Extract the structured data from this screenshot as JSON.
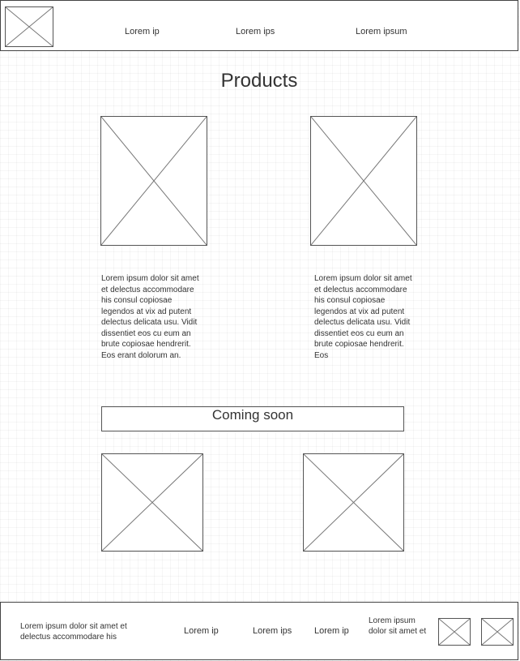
{
  "header": {
    "logo_icon": "image-placeholder-icon",
    "nav_links": [
      "Lorem ip",
      "Lorem ips",
      "Lorem ipsum"
    ]
  },
  "main": {
    "title": "Products",
    "products": [
      {
        "image_icon": "image-placeholder-icon",
        "description": "Lorem ipsum dolor sit amet et delectus accommodare his consul copiosae legendos at vix ad putent delectus delicata usu. Vidit dissentiet eos cu eum an brute copiosae hendrerit. Eos erant dolorum an."
      },
      {
        "image_icon": "image-placeholder-icon",
        "description": "Lorem ipsum dolor sit amet et delectus accommodare his consul copiosae legendos at vix ad putent delectus delicata usu. Vidit dissentiet eos cu eum an brute copiosae hendrerit. Eos"
      }
    ],
    "coming_soon_label": "Coming soon",
    "upcoming_images": [
      "image-placeholder-icon",
      "image-placeholder-icon"
    ]
  },
  "footer": {
    "about_text": "Lorem ipsum dolor sit amet et delectus accommodare his",
    "links": [
      "Lorem ip",
      "Lorem ips",
      "Lorem ip"
    ],
    "extra_text": "Lorem ipsum dolor sit amet et",
    "social_icons": [
      "image-placeholder-icon",
      "image-placeholder-icon"
    ]
  }
}
